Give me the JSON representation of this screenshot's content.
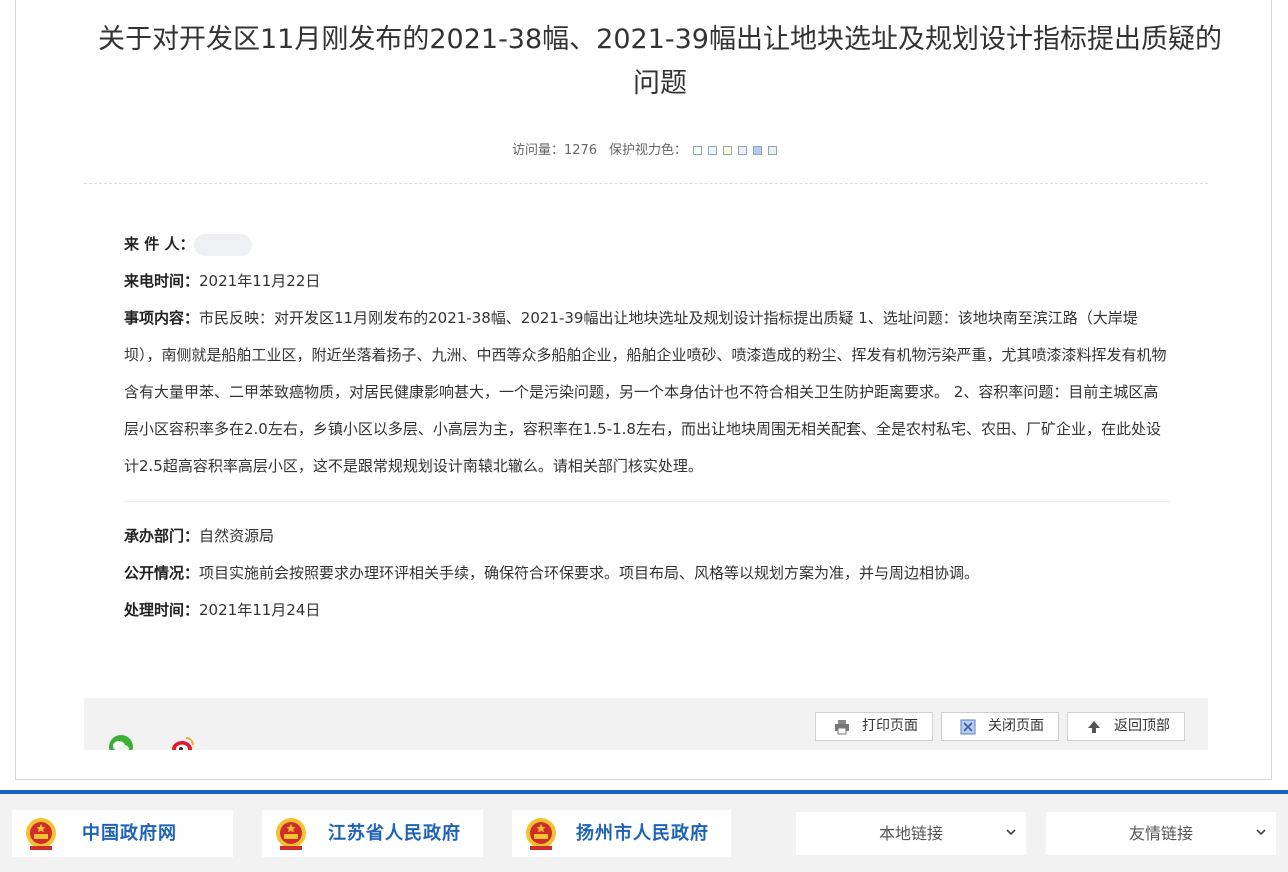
{
  "article": {
    "title": "关于对开发区11月刚发布的2021-38幅、2021-39幅出让地块选址及规划设计指标提出质疑的问题",
    "visits_label": "访问量：",
    "visits_value": "1276",
    "eye_care_label": "保护视力色：",
    "eye_care_colors": [
      "#fafff0",
      "#e6f7ff",
      "#fefce0",
      "#f9e8f5",
      "#b8cbef",
      "#eeeeee"
    ]
  },
  "letter": {
    "sender_label": "来 件 人：",
    "call_time_label": "来电时间：",
    "call_time_value": "2021年11月22日",
    "content_label": "事项内容：",
    "content_value": "市民反映：对开发区11月刚发布的2021-38幅、2021-39幅出让地块选址及规划设计指标提出质疑 1、选址问题：该地块南至滨江路（大岸堤坝），南侧就是船舶工业区，附近坐落着扬子、九洲、中西等众多船舶企业，船舶企业喷砂、喷漆造成的粉尘、挥发有机物污染严重，尤其喷漆漆料挥发有机物含有大量甲苯、二甲苯致癌物质，对居民健康影响甚大，一个是污染问题，另一个本身估计也不符合相关卫生防护距离要求。 2、容积率问题：目前主城区高层小区容积率多在2.0左右，乡镇小区以多层、小高层为主，容积率在1.5-1.8左右，而出让地块周围无相关配套、全是农村私宅、农田、厂矿企业，在此处设计2.5超高容积率高层小区，这不是跟常规规划设计南辕北辙么。请相关部门核实处理。"
  },
  "reply": {
    "dept_label": "承办部门：",
    "dept_value": "自然资源局",
    "public_label": "公开情况：",
    "public_value": "项目实施前会按照要求办理环评相关手续，确保符合环保要求。项目布局、风格等以规划方案为准，并与周边相协调。",
    "time_label": "处理时间：",
    "time_value": "2021年11月24日"
  },
  "toolbar": {
    "print_label": "打印页面",
    "close_label": "关闭页面",
    "top_label": "返回顶部"
  },
  "footer": {
    "links": [
      "中国政府网",
      "江苏省人民政府",
      "扬州市人民政府"
    ],
    "local_links_label": "本地链接",
    "friend_links_label": "友情链接"
  },
  "colors": {
    "footer_border": "#1565c0",
    "footer_link_text": "#1e63b6",
    "emblem_red": "#d22b2b",
    "emblem_gold": "#f2c230"
  }
}
